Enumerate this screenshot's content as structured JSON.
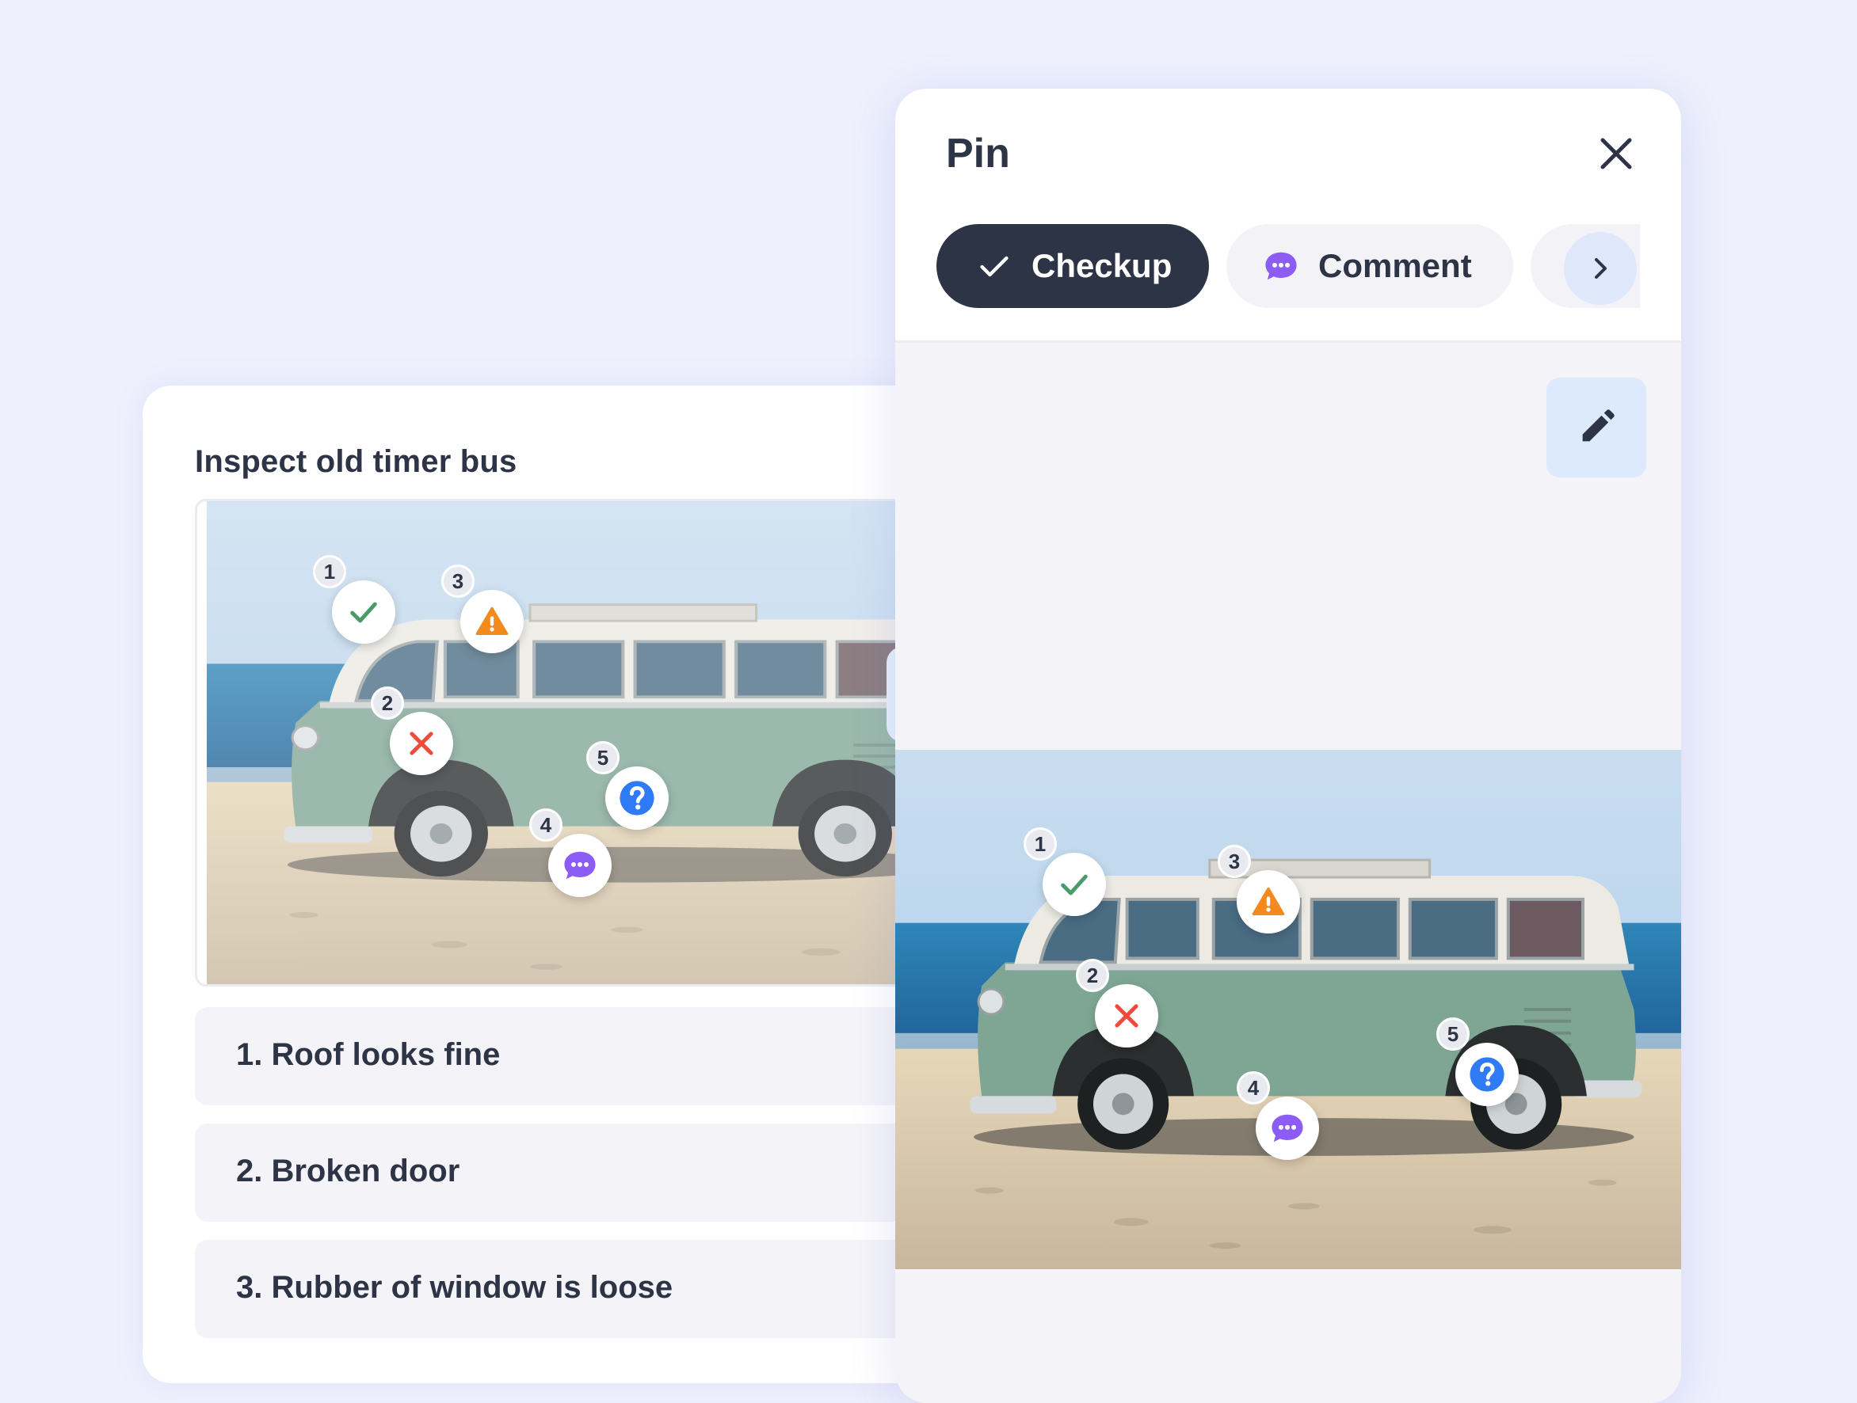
{
  "left_card": {
    "title": "Inspect old timer bus",
    "add_icon": "plus-icon",
    "checklist": [
      {
        "label": "1. Roof looks fine"
      },
      {
        "label": "2. Broken door"
      },
      {
        "label": "3. Rubber of window is loose"
      }
    ]
  },
  "panel": {
    "title": "Pin",
    "close_icon": "close-icon",
    "chips": {
      "checkup": {
        "label": "Checkup",
        "icon": "checkmark-icon"
      },
      "comment": {
        "label": "Comment",
        "icon": "comment-bubble-icon"
      },
      "next_icon": "chevron-right-icon"
    },
    "edit_icon": "pencil-icon"
  },
  "pins": [
    {
      "number": "1",
      "icon": "check-icon",
      "color": "#4a9a6a"
    },
    {
      "number": "2",
      "icon": "x-icon",
      "color": "#ef4a3a"
    },
    {
      "number": "3",
      "icon": "warning-icon",
      "color": "#f28a1e"
    },
    {
      "number": "4",
      "icon": "comment-icon",
      "color": "#8b5cf6"
    },
    {
      "number": "5",
      "icon": "question-icon",
      "color": "#2f7af5"
    }
  ],
  "colors": {
    "background": "#eef0fd",
    "dark_chip": "#2d3446",
    "accent_blue_light": "#dde9fc",
    "comment_purple": "#8b5cf6"
  }
}
